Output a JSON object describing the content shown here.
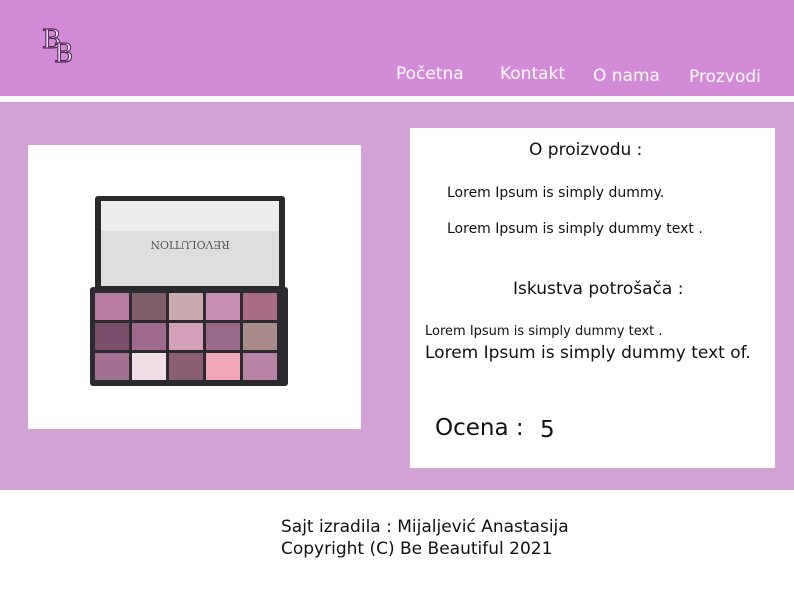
{
  "header": {
    "logo_letters": "BB",
    "nav": [
      "Početna",
      "Kontakt",
      "O nama",
      "Prozvodi"
    ]
  },
  "product": {
    "image_alt": "Revolution eyeshadow palette",
    "brand_on_palette": "REVOLUTION",
    "about_title": "O proizvodu :",
    "about_line1": "Lorem Ipsum is simply dummy.",
    "about_line2": "Lorem Ipsum is simply dummy text .",
    "experience_title": "Iskustva potrošača :",
    "experience_line1": "Lorem Ipsum is simply dummy text .",
    "experience_line2": "Lorem Ipsum is simply dummy text of.",
    "rating_label": "Ocena :",
    "rating_value": "5"
  },
  "footer": {
    "author": "Sajt izradila : Mijaljević Anastasija",
    "copyright": "Copyright (C) Be Beautiful 2021"
  },
  "colors": {
    "header": "#d38ad7",
    "main": "#d2a2d4"
  }
}
